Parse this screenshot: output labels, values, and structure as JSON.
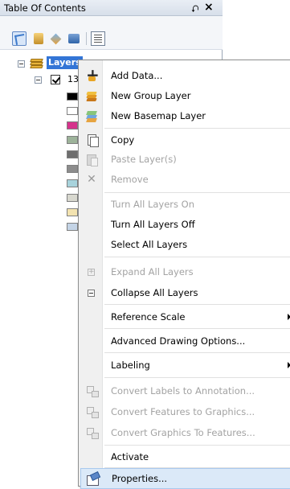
{
  "toc": {
    "title": "Table Of Contents",
    "pin_glyph": "⮏",
    "close_glyph": "×",
    "toolbar_icons": [
      "list-by-drawing-order-icon",
      "list-by-source-icon",
      "list-by-visibility-icon",
      "list-by-selection-icon",
      "options-icon"
    ],
    "tree": {
      "root_label": "Layers",
      "sub_label": "13",
      "swatches": [
        "#000000",
        "#ffffff",
        "#d6338c",
        "#9db39a",
        "#6e6e6e",
        "#8c8c8c",
        "#a8d3dc",
        "#d8d8cf",
        "#f3e3b0",
        "#c4d4e6"
      ]
    }
  },
  "menu": {
    "items": [
      {
        "label": "Add Data...",
        "icon": "add-data-icon",
        "enabled": true
      },
      {
        "label": "New Group Layer",
        "icon": "group-layer-icon",
        "enabled": true
      },
      {
        "label": "New Basemap Layer",
        "icon": "basemap-layer-icon",
        "enabled": true
      },
      {
        "label": "Copy",
        "icon": "copy-icon",
        "enabled": true
      },
      {
        "label": "Paste Layer(s)",
        "icon": "paste-icon",
        "enabled": false
      },
      {
        "label": "Remove",
        "icon": "remove-icon",
        "enabled": false
      },
      {
        "label": "Turn All Layers On",
        "enabled": false
      },
      {
        "label": "Turn All Layers Off",
        "enabled": true
      },
      {
        "label": "Select All Layers",
        "enabled": true
      },
      {
        "label": "Expand All Layers",
        "icon": "expand-icon",
        "enabled": false
      },
      {
        "label": "Collapse All Layers",
        "icon": "collapse-icon",
        "enabled": true
      },
      {
        "label": "Reference Scale",
        "enabled": true,
        "submenu": true
      },
      {
        "label": "Advanced Drawing Options...",
        "enabled": true
      },
      {
        "label": "Labeling",
        "enabled": true,
        "submenu": true
      },
      {
        "label": "Convert Labels to Annotation...",
        "icon": "convert-labels-icon",
        "enabled": false
      },
      {
        "label": "Convert Features to Graphics...",
        "icon": "convert-features-icon",
        "enabled": false
      },
      {
        "label": "Convert Graphics To Features...",
        "icon": "convert-graphics-icon",
        "enabled": false
      },
      {
        "label": "Activate",
        "enabled": true
      },
      {
        "label": "Properties...",
        "icon": "properties-icon",
        "enabled": true,
        "highlighted": true
      }
    ]
  }
}
